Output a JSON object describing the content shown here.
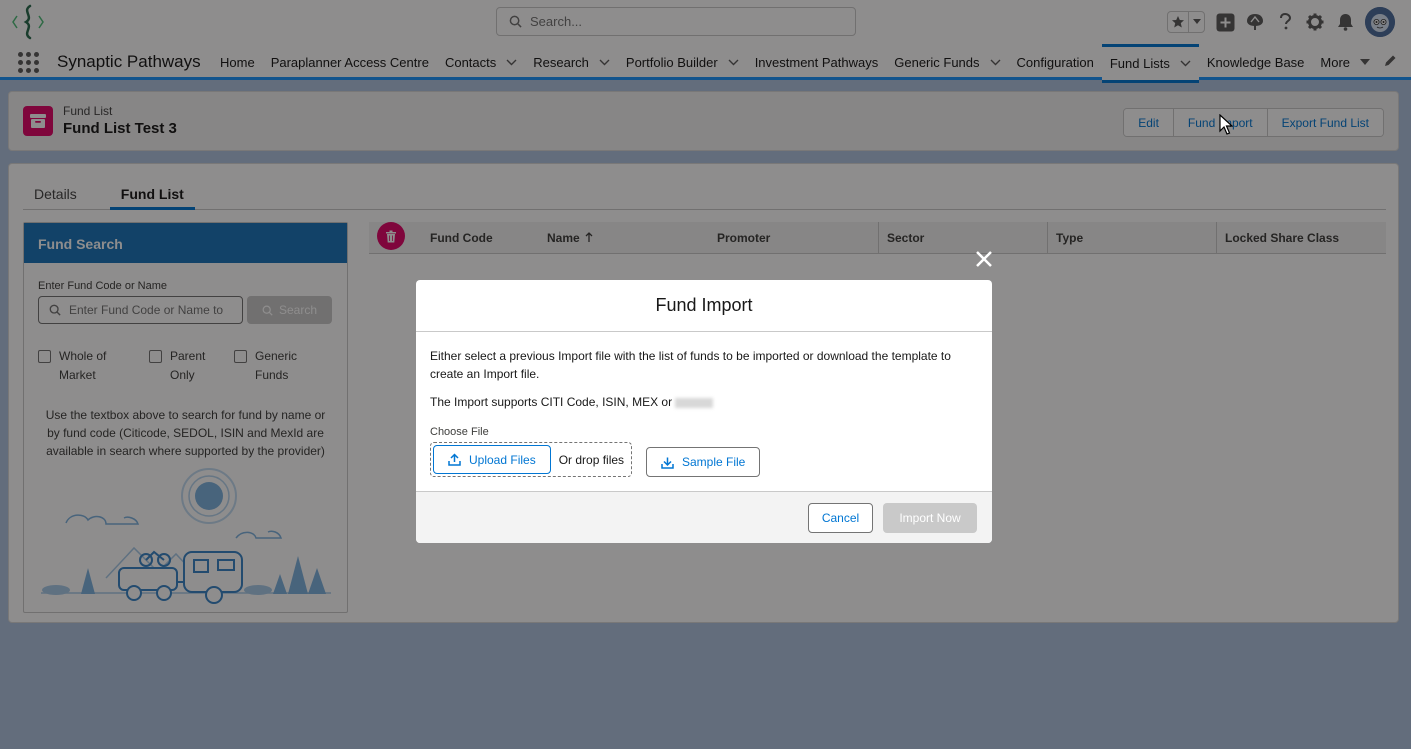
{
  "header": {
    "search_placeholder": "Search..."
  },
  "nav": {
    "app_name": "Synaptic Pathways",
    "items": [
      {
        "label": "Home",
        "has_chevron": false
      },
      {
        "label": "Paraplanner Access Centre",
        "has_chevron": false
      },
      {
        "label": "Contacts",
        "has_chevron": true
      },
      {
        "label": "Research",
        "has_chevron": true
      },
      {
        "label": "Portfolio Builder",
        "has_chevron": true
      },
      {
        "label": "Investment Pathways",
        "has_chevron": false
      },
      {
        "label": "Generic Funds",
        "has_chevron": true
      },
      {
        "label": "Configuration",
        "has_chevron": false
      },
      {
        "label": "Fund Lists",
        "has_chevron": true,
        "active": true
      },
      {
        "label": "Knowledge Base",
        "has_chevron": false
      },
      {
        "label": "More",
        "has_chevron": true
      }
    ]
  },
  "record": {
    "type_label": "Fund List",
    "title": "Fund List Test 3",
    "buttons": {
      "edit": "Edit",
      "fund_import": "Fund Import",
      "export": "Export Fund List"
    }
  },
  "tabs": {
    "details": "Details",
    "fund_list": "Fund List"
  },
  "fund_search": {
    "title": "Fund Search",
    "input_label": "Enter Fund Code or Name",
    "input_placeholder": "Enter Fund Code or Name to",
    "search_button": "Search",
    "checkboxes": [
      {
        "line1": "Whole of",
        "line2": "Market"
      },
      {
        "line1": "Parent",
        "line2": "Only"
      },
      {
        "line1": "Generic",
        "line2": "Funds"
      }
    ],
    "help_text": "Use the textbox above to search for fund by name or by fund code (Citicode, SEDOL, ISIN and MexId are available in search where supported by the provider)"
  },
  "table": {
    "columns": {
      "fund_code": "Fund Code",
      "name": "Name",
      "promoter": "Promoter",
      "sector": "Sector",
      "type": "Type",
      "locked": "Locked Share Class"
    }
  },
  "modal": {
    "title": "Fund Import",
    "description": "Either select a previous Import file with the list of funds to be imported or download the template to create an Import file.",
    "supports_text": "The Import supports CITI Code, ISIN, MEX or",
    "choose_file_label": "Choose File",
    "upload_button": "Upload Files",
    "drop_text": "Or drop files",
    "sample_button": "Sample File",
    "cancel_button": "Cancel",
    "import_button": "Import Now"
  },
  "colors": {
    "brand_blue": "#0176d3",
    "panel_header": "#1b75bb",
    "record_icon": "#e3066a",
    "nav_active": "#1b96ff"
  }
}
